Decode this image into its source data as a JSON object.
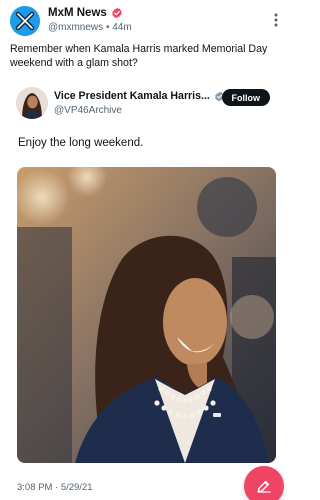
{
  "post": {
    "author_name": "MxM News",
    "handle": "@mxmnews",
    "separator": "•",
    "time": "44m",
    "text": "Remember when Kamala Harris marked Memorial Day weekend with a glam shot?"
  },
  "quoted": {
    "author_name": "Vice President Kamala Harris...",
    "handle": "@VP46Archive",
    "follow_label": "Follow",
    "text": "Enjoy the long weekend.",
    "timestamp": "3:08 PM · 5/29/21"
  },
  "icons": {
    "more": "more-vertical-icon",
    "verified_main": "verified-badge-red",
    "verified_quote": "verified-badge-gray",
    "compose": "compose-icon"
  },
  "colors": {
    "brand_red": "#ef4463",
    "follow_bg": "#0f1419",
    "muted_text": "#536471",
    "verified_gray": "#829aab"
  }
}
